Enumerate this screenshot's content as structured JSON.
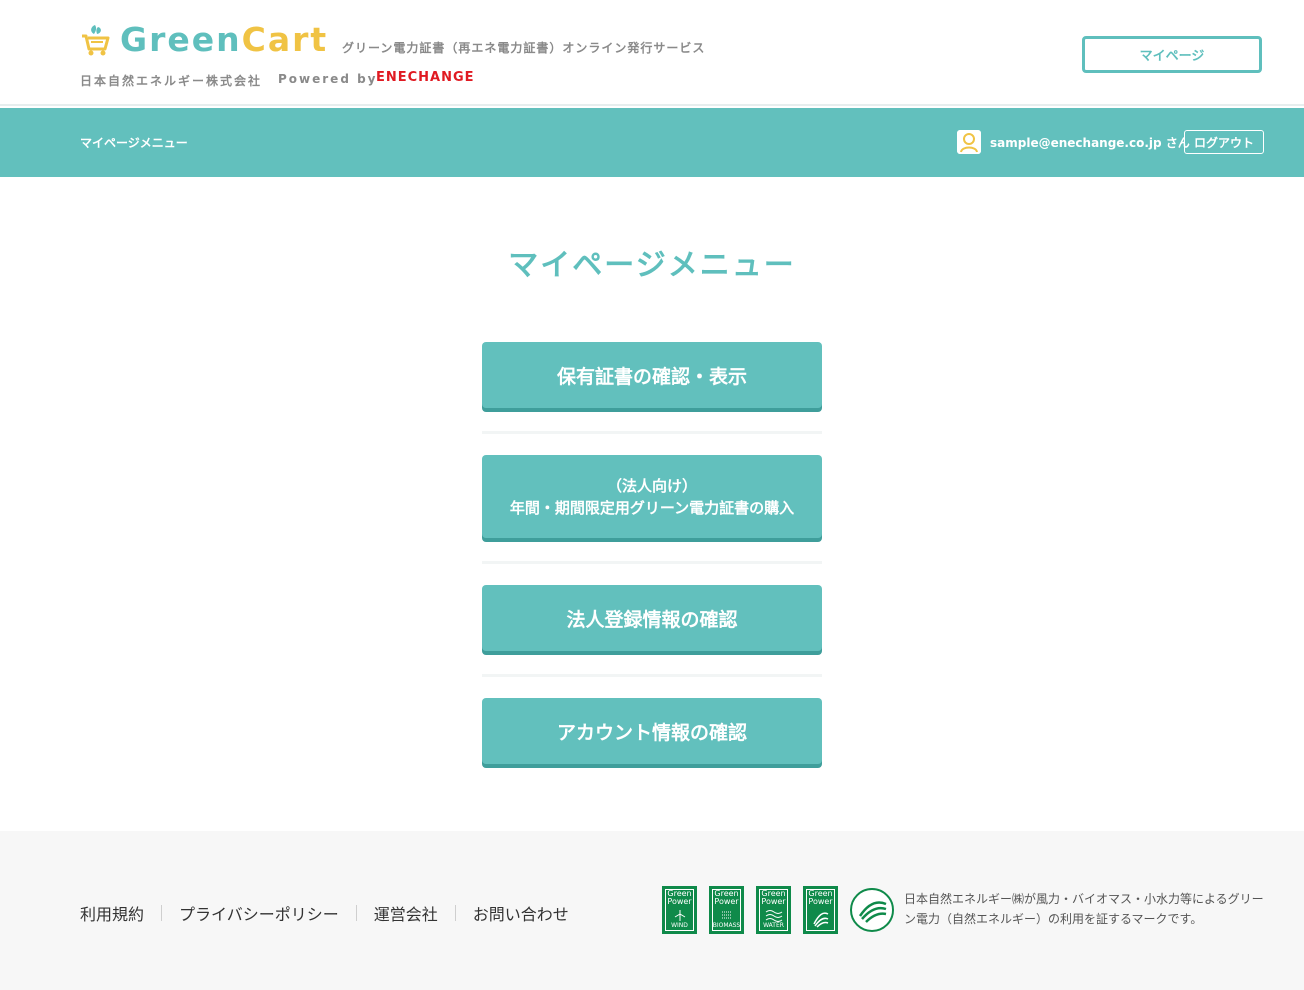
{
  "header": {
    "logo_green": "Green",
    "logo_cart": "Cart",
    "tagline": "グリーン電力証書（再エネ電力証書）オンライン発行サービス",
    "company": "日本自然エネルギー株式会社",
    "powered_by": "Powered by",
    "enechange": "ENECHANGE",
    "mypage_button": "マイページ"
  },
  "navbar": {
    "title": "マイページメニュー",
    "user_email": "sample@enechange.co.jp さん",
    "logout_button": "ログアウト"
  },
  "main": {
    "page_title": "マイページメニュー",
    "menu": [
      {
        "label": "保有証書の確認・表示"
      },
      {
        "line1": "（法人向け）",
        "line2": "年間・期間限定用グリーン電力証書の購入"
      },
      {
        "label": "法人登録情報の確認"
      },
      {
        "label": "アカウント情報の確認"
      }
    ]
  },
  "footer": {
    "links": [
      "利用規約",
      "プライバシーポリシー",
      "運営会社",
      "お問い合わせ"
    ],
    "marks": [
      {
        "line1": "Green",
        "line2": "Power",
        "sub": "WIND"
      },
      {
        "line1": "Green",
        "line2": "Power",
        "sub": "BIOMASS"
      },
      {
        "line1": "Green",
        "line2": "Power",
        "sub": "WATER"
      },
      {
        "line1": "Green",
        "line2": "Power",
        "sub": ""
      }
    ],
    "round_mark": "GREEN POWER",
    "note": "日本自然エネルギー㈱が風力・バイオマス・小水力等によるグリーン電力（自然エネルギー）の利用を証するマークです。"
  },
  "colors": {
    "teal": "#62c0bd",
    "teal_shadow": "#3f9e9b",
    "yellow": "#f0c344",
    "enechange_red": "#e01a22",
    "green_power": "#0f8a4a"
  }
}
